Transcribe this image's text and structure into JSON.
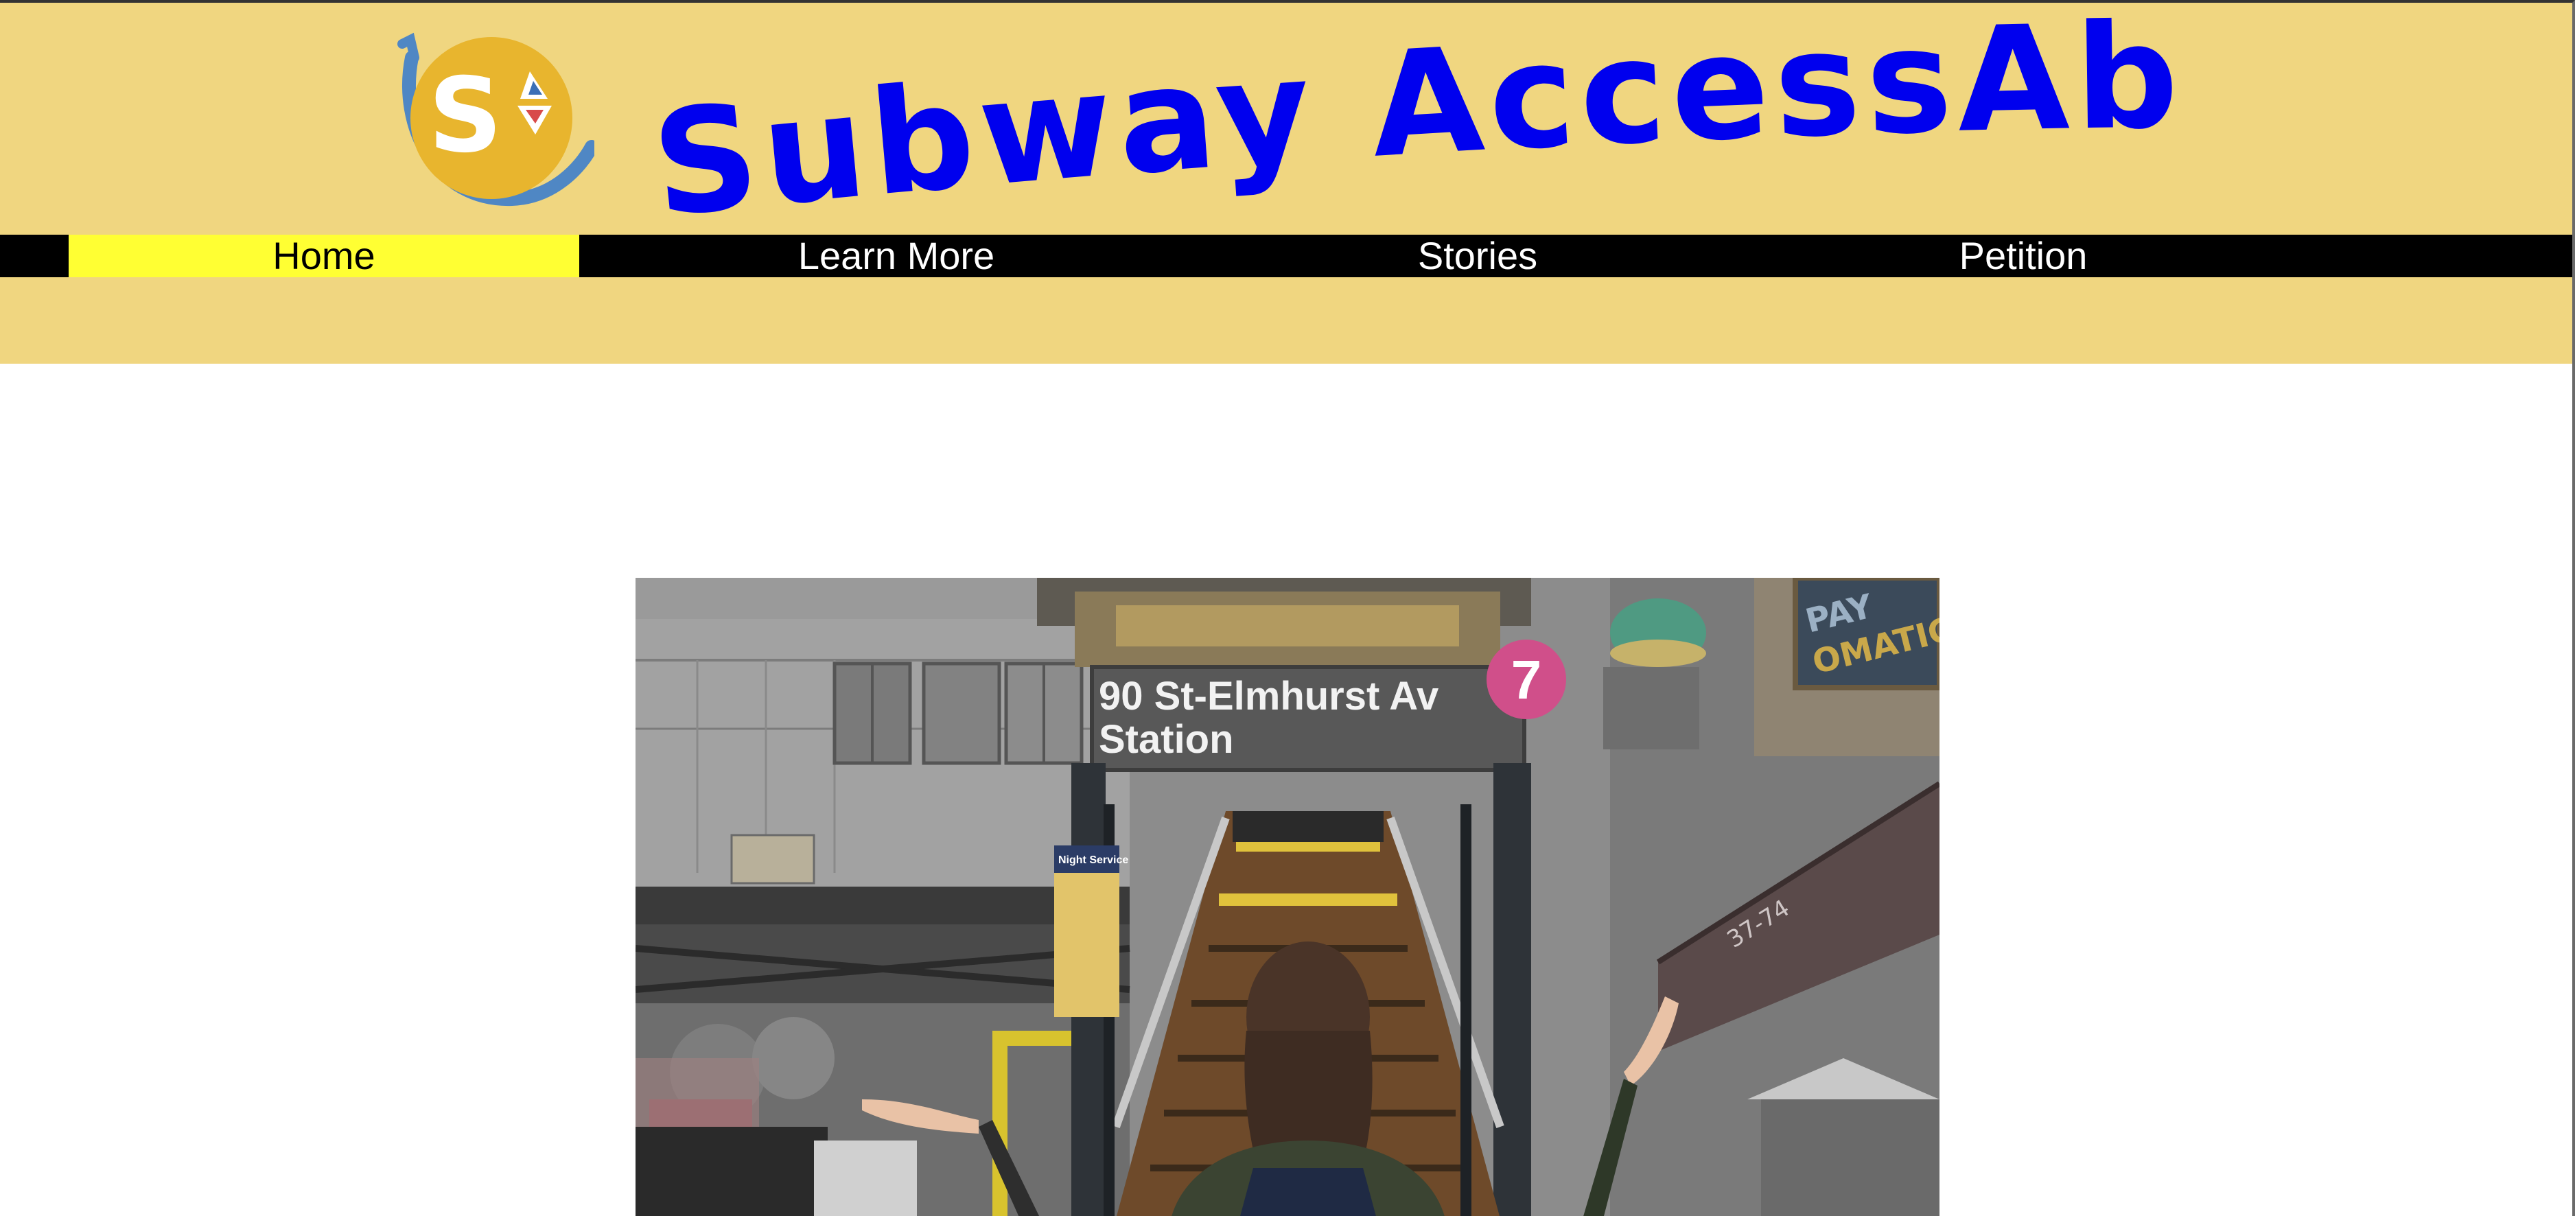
{
  "header": {
    "title": "Subway AccessAbility",
    "logo_letter": "S",
    "title_color": "#0000ee",
    "background_color": "#f0d680"
  },
  "nav": {
    "items": [
      {
        "label": "Home",
        "active": true
      },
      {
        "label": "Learn More",
        "active": false
      },
      {
        "label": "Stories",
        "active": false
      },
      {
        "label": "Petition",
        "active": false
      }
    ],
    "active_color": "#ffff33"
  },
  "hero": {
    "sign_line1": "90 St-Elmhurst Av",
    "sign_line2": "Station",
    "route": "7",
    "building_number": "37-74",
    "awning_text": "PAY\nOMATIC",
    "poster_title": "Night Service"
  }
}
